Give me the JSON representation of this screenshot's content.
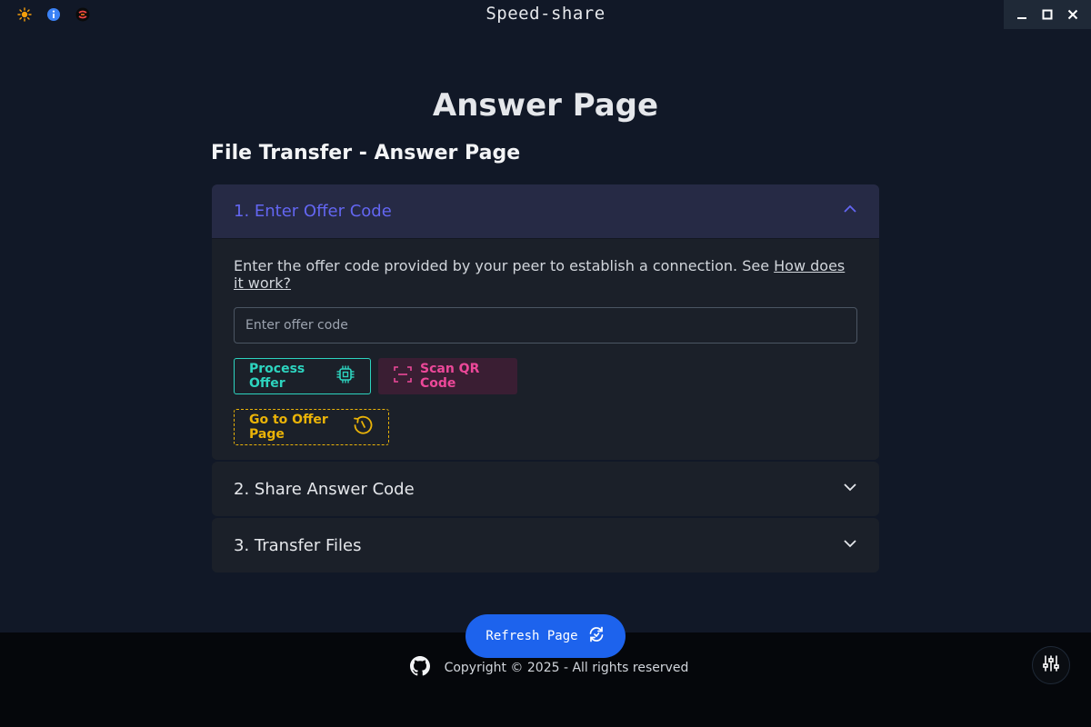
{
  "window": {
    "title": "Speed-share",
    "left_icons": [
      "sun-icon",
      "info-icon",
      "app-logo-icon"
    ],
    "controls": [
      "minimize-icon",
      "maximize-icon",
      "close-icon"
    ]
  },
  "page": {
    "heading": "Answer Page",
    "subheading": "File Transfer - Answer Page"
  },
  "accordion": {
    "step1": {
      "title": "1. Enter Offer Code",
      "description": "Enter the offer code provided by your peer to establish a connection. See ",
      "link": "How does it work?",
      "input_placeholder": "Enter offer code",
      "input_value": "",
      "process_label": "Process Offer",
      "scan_label": "Scan QR Code",
      "goto_label": "Go to Offer Page",
      "expanded": true
    },
    "step2": {
      "title": "2. Share Answer Code",
      "expanded": false
    },
    "step3": {
      "title": "3. Transfer Files",
      "expanded": false
    }
  },
  "footer": {
    "refresh_label": "Refresh Page",
    "copyright": "Copyright © 2025 - All rights reserved"
  },
  "colors": {
    "background": "#111827",
    "accent_indigo": "#6366f1",
    "teal": "#2dd4bf",
    "pink": "#ec4899",
    "yellow": "#eab308",
    "refresh_blue": "#1d63ed"
  }
}
